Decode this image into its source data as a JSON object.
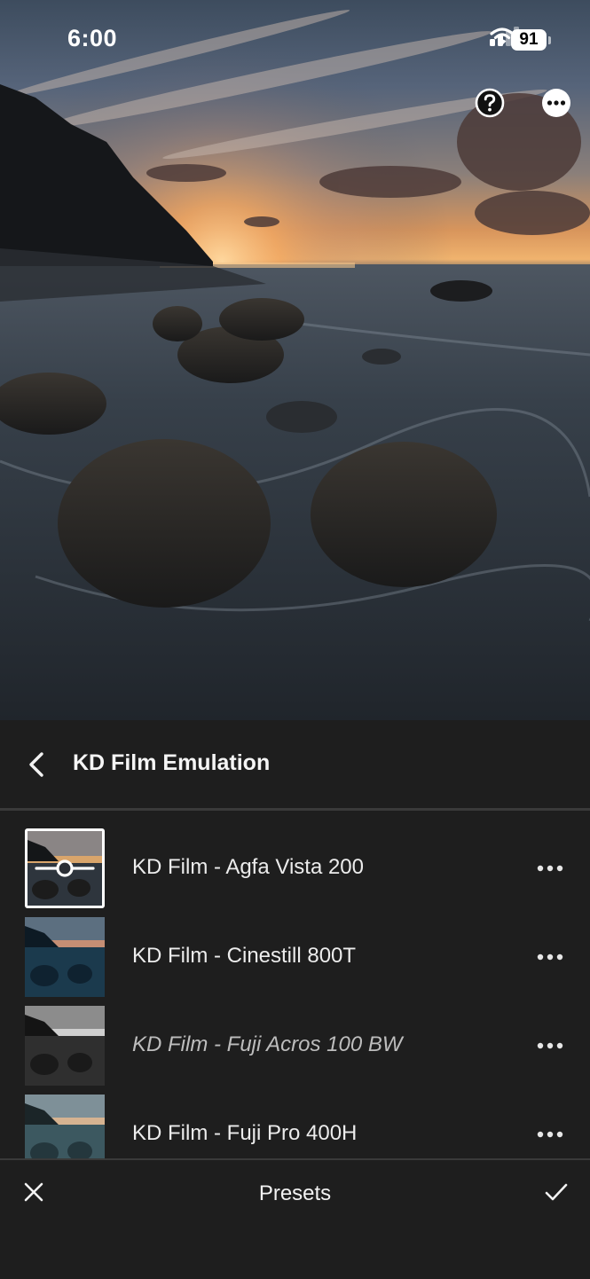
{
  "status_bar": {
    "time": "6:00",
    "battery": "91",
    "icons": [
      "signal-icon",
      "wifi-icon",
      "battery-icon"
    ]
  },
  "photo": {
    "subject": "sunset over rocky beach",
    "top_icons": [
      "help-icon",
      "more-options-icon"
    ]
  },
  "panel": {
    "title": "KD Film Emulation",
    "presets": [
      {
        "name": "KD Film - Agfa Vista 200",
        "selected": true,
        "italic": false
      },
      {
        "name": "KD Film - Cinestill 800T",
        "selected": false,
        "italic": false
      },
      {
        "name": "KD Film - Fuji Acros 100 BW",
        "selected": false,
        "italic": true
      },
      {
        "name": "KD Film - Fuji Pro 400H",
        "selected": false,
        "italic": false
      }
    ]
  },
  "bottom_bar": {
    "title": "Presets"
  },
  "colors": {
    "panel_bg": "#1e1e1e",
    "divider": "#3a3a3a",
    "text": "#f2f2f2"
  }
}
